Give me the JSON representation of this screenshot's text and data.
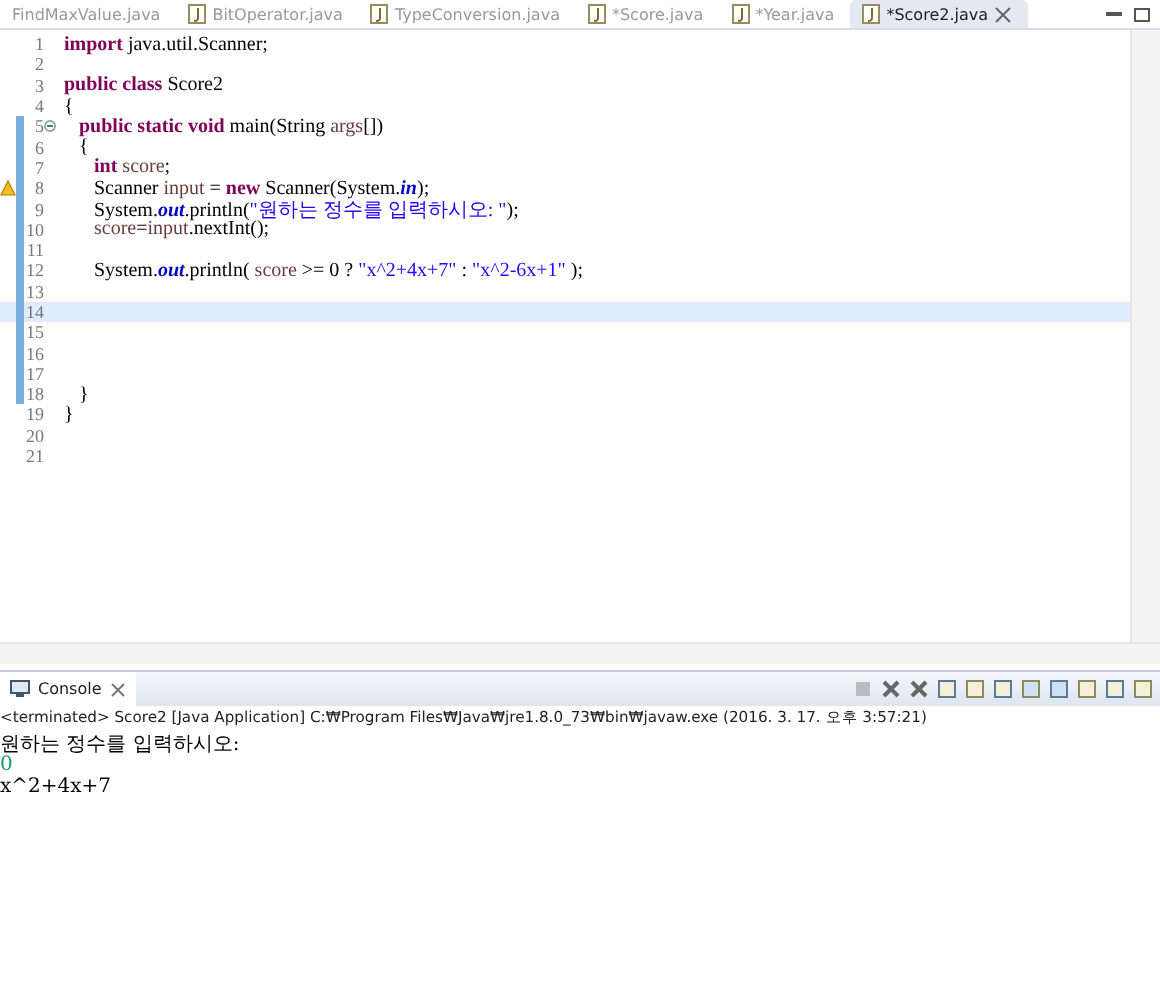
{
  "editor_tabs": [
    {
      "label": "FindMaxValue.java",
      "selected": false
    },
    {
      "label": "BitOperator.java",
      "selected": false
    },
    {
      "label": "TypeConversion.java",
      "selected": false
    },
    {
      "label": "*Score.java",
      "selected": false
    },
    {
      "label": "*Year.java",
      "selected": false
    },
    {
      "label": "*Score2.java",
      "selected": true
    }
  ],
  "code_lines": [
    {
      "number": "1",
      "changed": false,
      "segments": [
        {
          "kind": "kw",
          "text": "import"
        },
        {
          "kind": "txt",
          "text": " java.util.Scanner;"
        }
      ]
    },
    {
      "number": "2",
      "changed": false
    },
    {
      "number": "3",
      "changed": false,
      "segments": [
        {
          "kind": "kw",
          "text": "public class"
        },
        {
          "kind": "txt",
          "text": " Score2"
        }
      ]
    },
    {
      "number": "4",
      "changed": false,
      "segments": [
        {
          "kind": "txt",
          "text": "{"
        }
      ]
    },
    {
      "number": "5",
      "changed": true,
      "fold": true,
      "segments": [
        {
          "kind": "kw",
          "text": "   public static void"
        },
        {
          "kind": "txt",
          "text": " main(String "
        },
        {
          "kind": "var",
          "text": "args"
        },
        {
          "kind": "txt",
          "text": "[])"
        }
      ]
    },
    {
      "number": "6",
      "changed": true,
      "segments": [
        {
          "kind": "txt",
          "text": "   {"
        }
      ]
    },
    {
      "number": "7",
      "changed": true,
      "segments": [
        {
          "kind": "kw",
          "text": "      int"
        },
        {
          "kind": "var",
          "text": " score"
        },
        {
          "kind": "txt",
          "text": ";"
        }
      ]
    },
    {
      "number": "8",
      "changed": true,
      "warning": true,
      "segments": [
        {
          "kind": "txt",
          "text": "      Scanner "
        },
        {
          "kind": "var",
          "text": "input"
        },
        {
          "kind": "txt",
          "text": " = "
        },
        {
          "kind": "kw",
          "text": "new"
        },
        {
          "kind": "txt",
          "text": " Scanner(System."
        },
        {
          "kind": "static",
          "text": "in"
        },
        {
          "kind": "txt",
          "text": ");"
        }
      ]
    },
    {
      "number": "9",
      "changed": true,
      "segments": [
        {
          "kind": "txt",
          "text": "      System."
        },
        {
          "kind": "static",
          "text": "out"
        },
        {
          "kind": "txt",
          "text": ".println("
        },
        {
          "kind": "str",
          "text": "\"원하는 정수를 입력하시오: \""
        },
        {
          "kind": "txt",
          "text": ");"
        }
      ]
    },
    {
      "number": "10",
      "changed": true,
      "segments": [
        {
          "kind": "var",
          "text": "      score"
        },
        {
          "kind": "txt",
          "text": "="
        },
        {
          "kind": "var",
          "text": "input"
        },
        {
          "kind": "txt",
          "text": ".nextInt();"
        }
      ]
    },
    {
      "number": "11",
      "changed": true
    },
    {
      "number": "12",
      "changed": true,
      "segments": [
        {
          "kind": "txt",
          "text": "      System."
        },
        {
          "kind": "static",
          "text": "out"
        },
        {
          "kind": "txt",
          "text": ".println( "
        },
        {
          "kind": "var",
          "text": "score"
        },
        {
          "kind": "txt",
          "text": " >= 0 ? "
        },
        {
          "kind": "str",
          "text": "\"x^2+4x+7\""
        },
        {
          "kind": "txt",
          "text": " : "
        },
        {
          "kind": "str",
          "text": "\"x^2-6x+1\""
        },
        {
          "kind": "txt",
          "text": " );"
        }
      ]
    },
    {
      "number": "13",
      "changed": true
    },
    {
      "number": "14",
      "changed": true,
      "current": true
    },
    {
      "number": "15",
      "changed": true
    },
    {
      "number": "16",
      "changed": true
    },
    {
      "number": "17",
      "changed": true
    },
    {
      "number": "18",
      "changed": true,
      "segments": [
        {
          "kind": "txt",
          "text": "   }"
        }
      ]
    },
    {
      "number": "19",
      "changed": false,
      "segments": [
        {
          "kind": "txt",
          "text": "}"
        }
      ]
    },
    {
      "number": "20",
      "changed": false
    },
    {
      "number": "21",
      "changed": false
    }
  ],
  "console": {
    "title": "Console",
    "status": "<terminated> Score2 [Java Application] C:₩Program Files₩Java₩jre1.8.0_73₩bin₩javaw.exe (2016. 3. 17. 오후 3:57:21)",
    "output": [
      {
        "kind": "out",
        "text": "원하는 정수를 입력하시오: "
      },
      {
        "kind": "in",
        "text": "0"
      },
      {
        "kind": "out",
        "text": "x^2+4x+7"
      }
    ]
  }
}
